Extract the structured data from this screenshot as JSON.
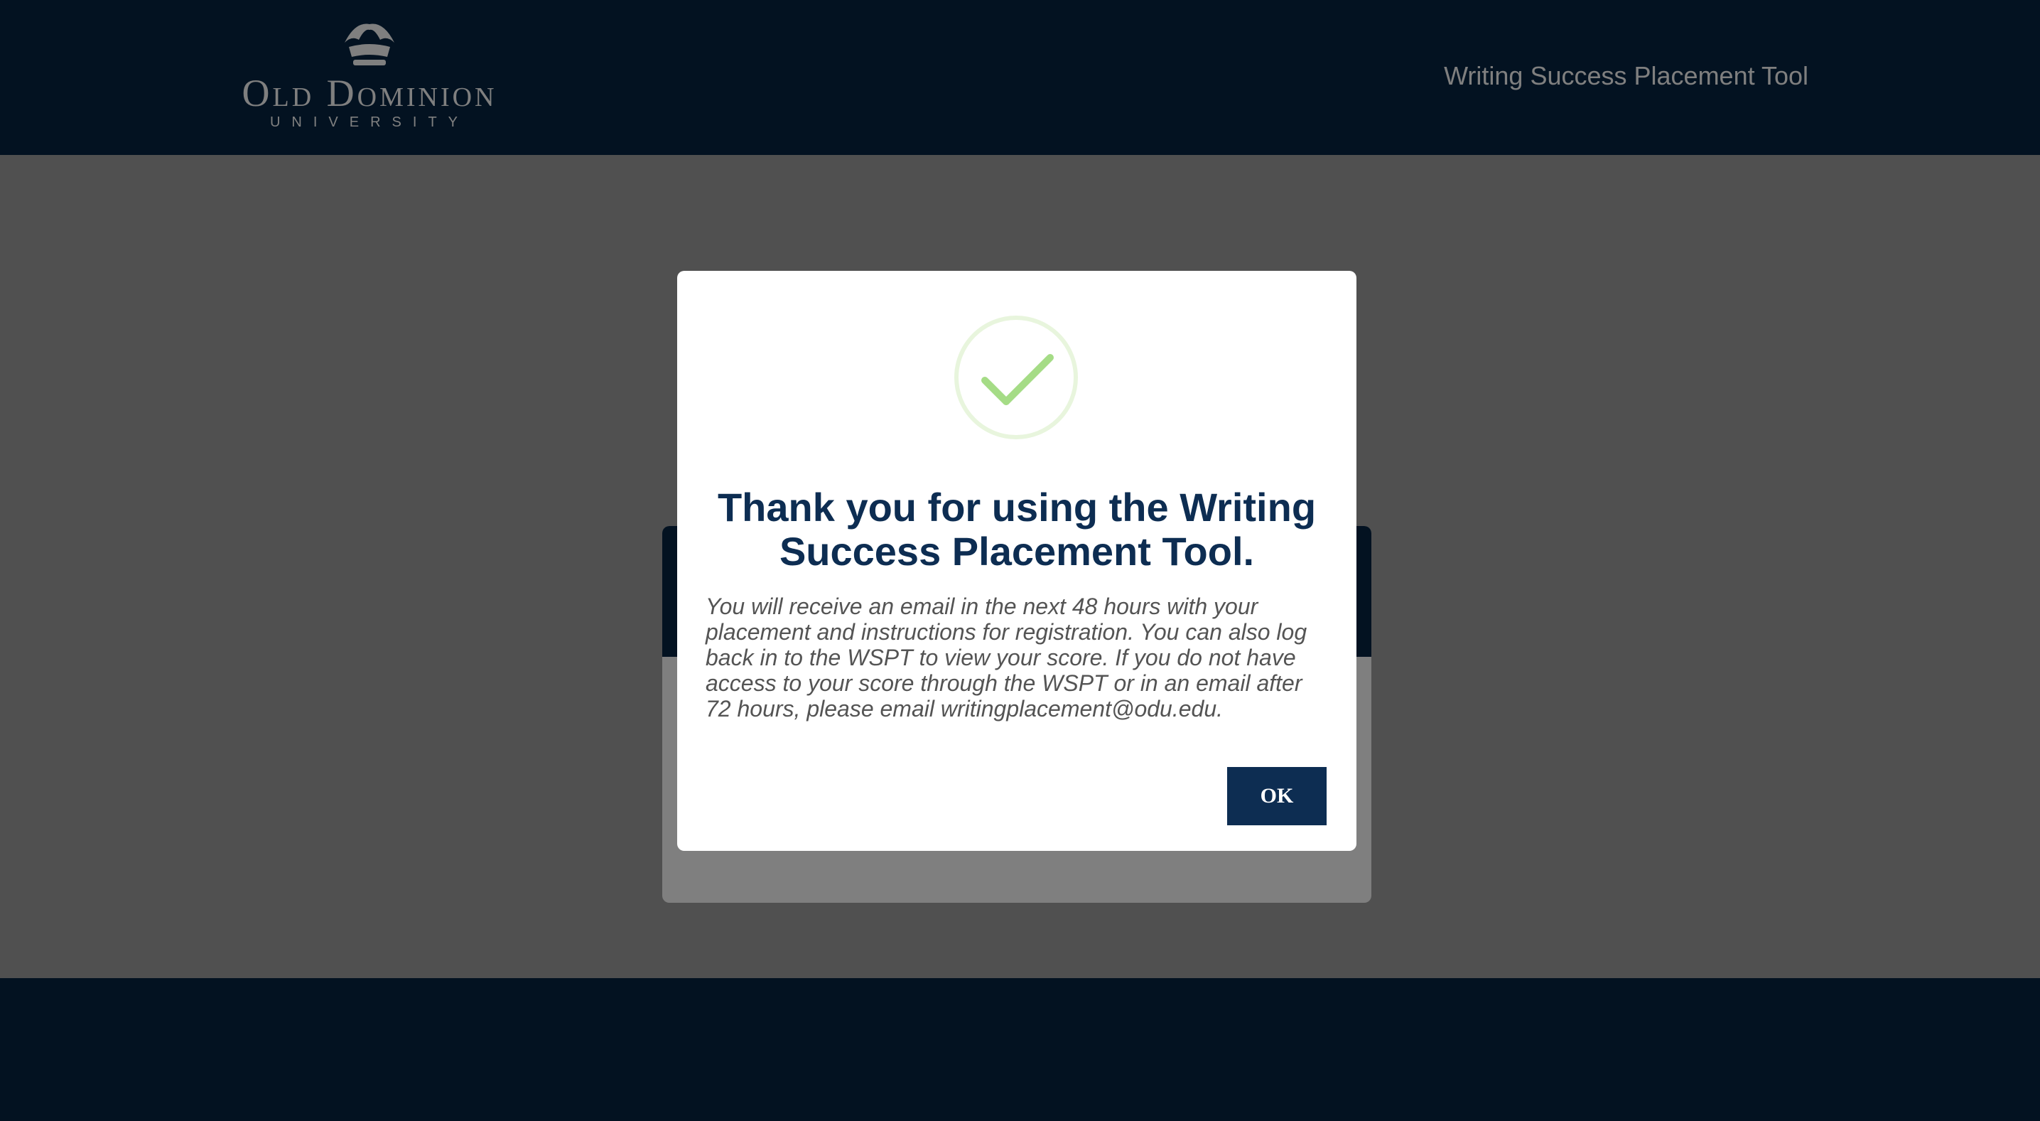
{
  "header": {
    "logo": {
      "icon": "crown-logo-icon",
      "name": "Old Dominion",
      "subtitle": "UNIVERSITY"
    },
    "title": "Writing Success Placement Tool"
  },
  "modal": {
    "icon": "checkmark-circle-icon",
    "title": "Thank you for using the Writing Success Placement Tool.",
    "message": "You will receive an email in the next 48 hours with your placement and instructions for registration. You can also log back in to the WSPT to view your score. If you do not have access to your score through the WSPT or in an email after 72 hours, please email writingplacement@odu.edu.",
    "ok_label": "OK"
  },
  "colors": {
    "navy": "#062443",
    "button": "#0d2d52",
    "success": "#a5dc86",
    "success_ring": "#e8f5dd",
    "body_text": "#545454"
  }
}
